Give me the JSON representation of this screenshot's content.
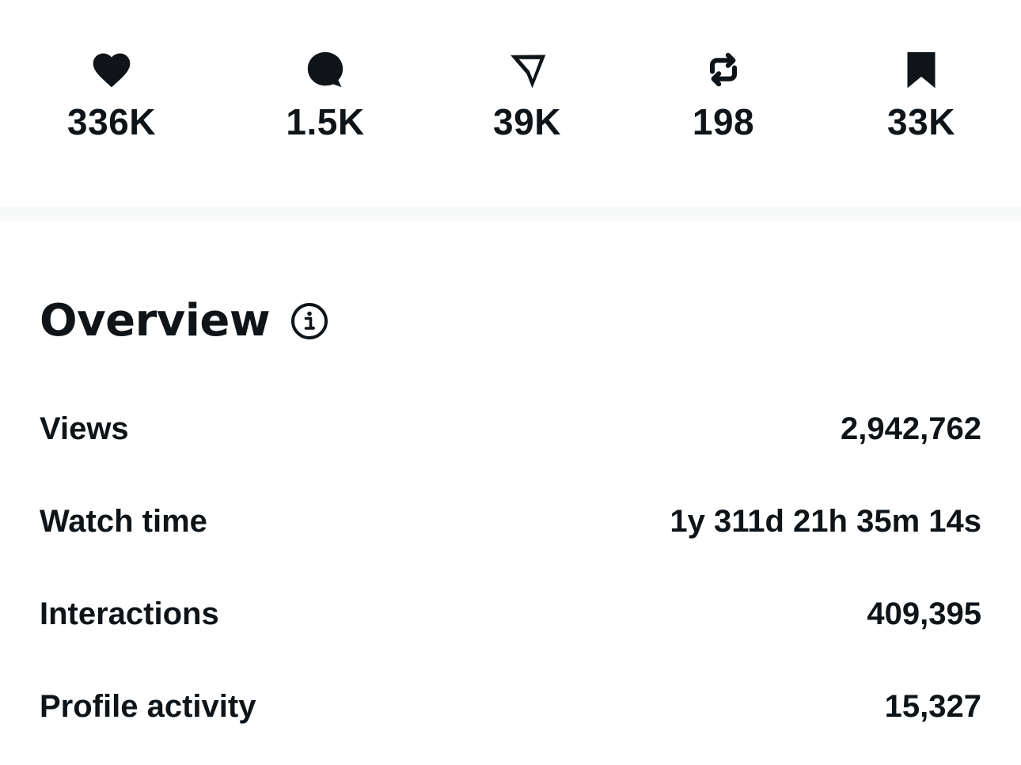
{
  "engagement": {
    "items": [
      {
        "icon": "heart-icon",
        "count": "336K"
      },
      {
        "icon": "reply-bubble-icon",
        "count": "1.5K"
      },
      {
        "icon": "share-arrow-icon",
        "count": "39K"
      },
      {
        "icon": "repost-icon",
        "count": "198"
      },
      {
        "icon": "bookmark-icon",
        "count": "33K"
      }
    ]
  },
  "overview": {
    "title": "Overview",
    "info_icon": "info-icon",
    "metrics": [
      {
        "label": "Views",
        "value": "2,942,762"
      },
      {
        "label": "Watch time",
        "value": "1y 311d 21h 35m 14s"
      },
      {
        "label": "Interactions",
        "value": "409,395"
      },
      {
        "label": "Profile activity",
        "value": "15,327"
      }
    ]
  },
  "colors": {
    "text": "#0f1419",
    "divider": "#f7f9f9",
    "background": "#ffffff"
  }
}
